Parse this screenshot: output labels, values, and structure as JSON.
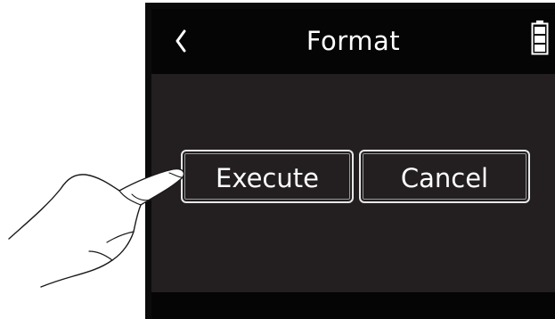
{
  "screen": {
    "title": "Format",
    "back_icon": "chevron-left-icon",
    "battery_icon": "battery-full-icon",
    "battery_level": 1.0
  },
  "dialog": {
    "execute_label": "Execute",
    "cancel_label": "Cancel"
  },
  "overlay": {
    "pointer": "hand-pointing-icon",
    "target": "execute"
  },
  "colors": {
    "bezel": "#0b0b0b",
    "screen_bg": "#231f20",
    "header_bg": "#050505",
    "text": "#ffffff",
    "button_border": "#e8e8e8"
  }
}
